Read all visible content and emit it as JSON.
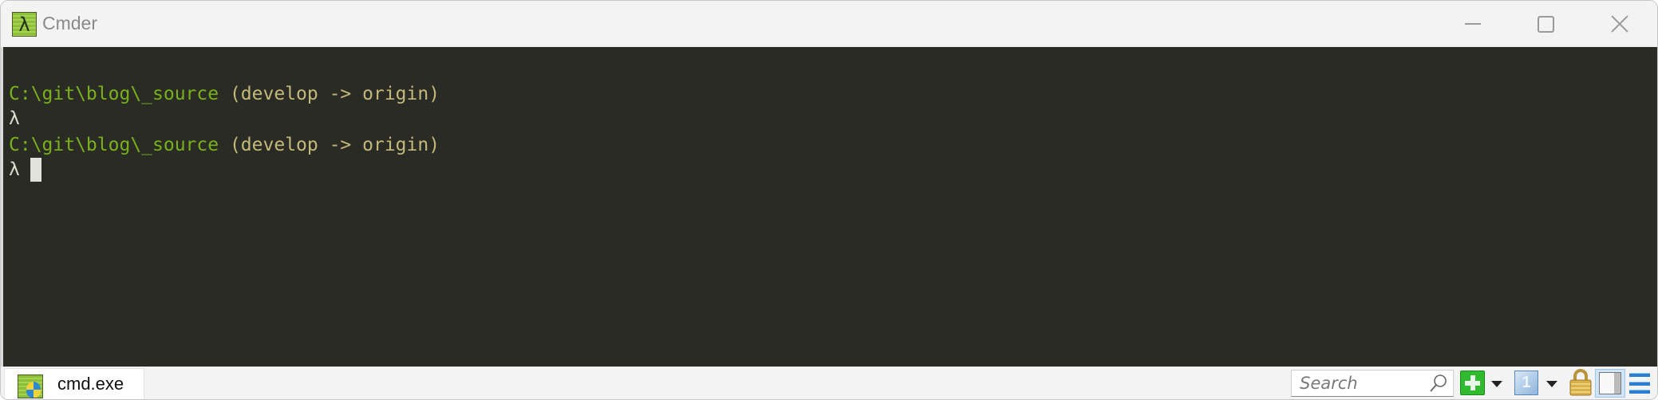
{
  "window": {
    "title": "Cmder",
    "app_icon": "lambda-icon",
    "app_icon_glyph": "λ",
    "controls": {
      "minimize": "minimize-icon",
      "maximize": "maximize-icon",
      "close": "close-icon"
    }
  },
  "terminal": {
    "lines": [
      {
        "path": "C:\\git\\blog\\_source",
        "branch": " (develop -> origin)"
      },
      {
        "prompt": "λ"
      },
      {
        "path": "C:\\git\\blog\\_source",
        "branch": " (develop -> origin)"
      },
      {
        "prompt": "λ"
      }
    ],
    "colors": {
      "background": "#2b2b25",
      "path": "#78b11a",
      "branch": "#c2b97a",
      "prompt": "#dcdcd0"
    }
  },
  "statusbar": {
    "tabs": [
      {
        "label": "cmd.exe",
        "icon": "cmd-console-icon",
        "active": true
      }
    ],
    "search": {
      "placeholder": "Search",
      "value": ""
    },
    "buttons": {
      "new_console": "plus-icon",
      "new_console_menu": "dropdown-arrow-icon",
      "console_number": "1",
      "console_menu": "dropdown-arrow-icon",
      "lock": "lock-icon",
      "split": "split-view-icon",
      "menu": "hamburger-menu-icon"
    }
  }
}
